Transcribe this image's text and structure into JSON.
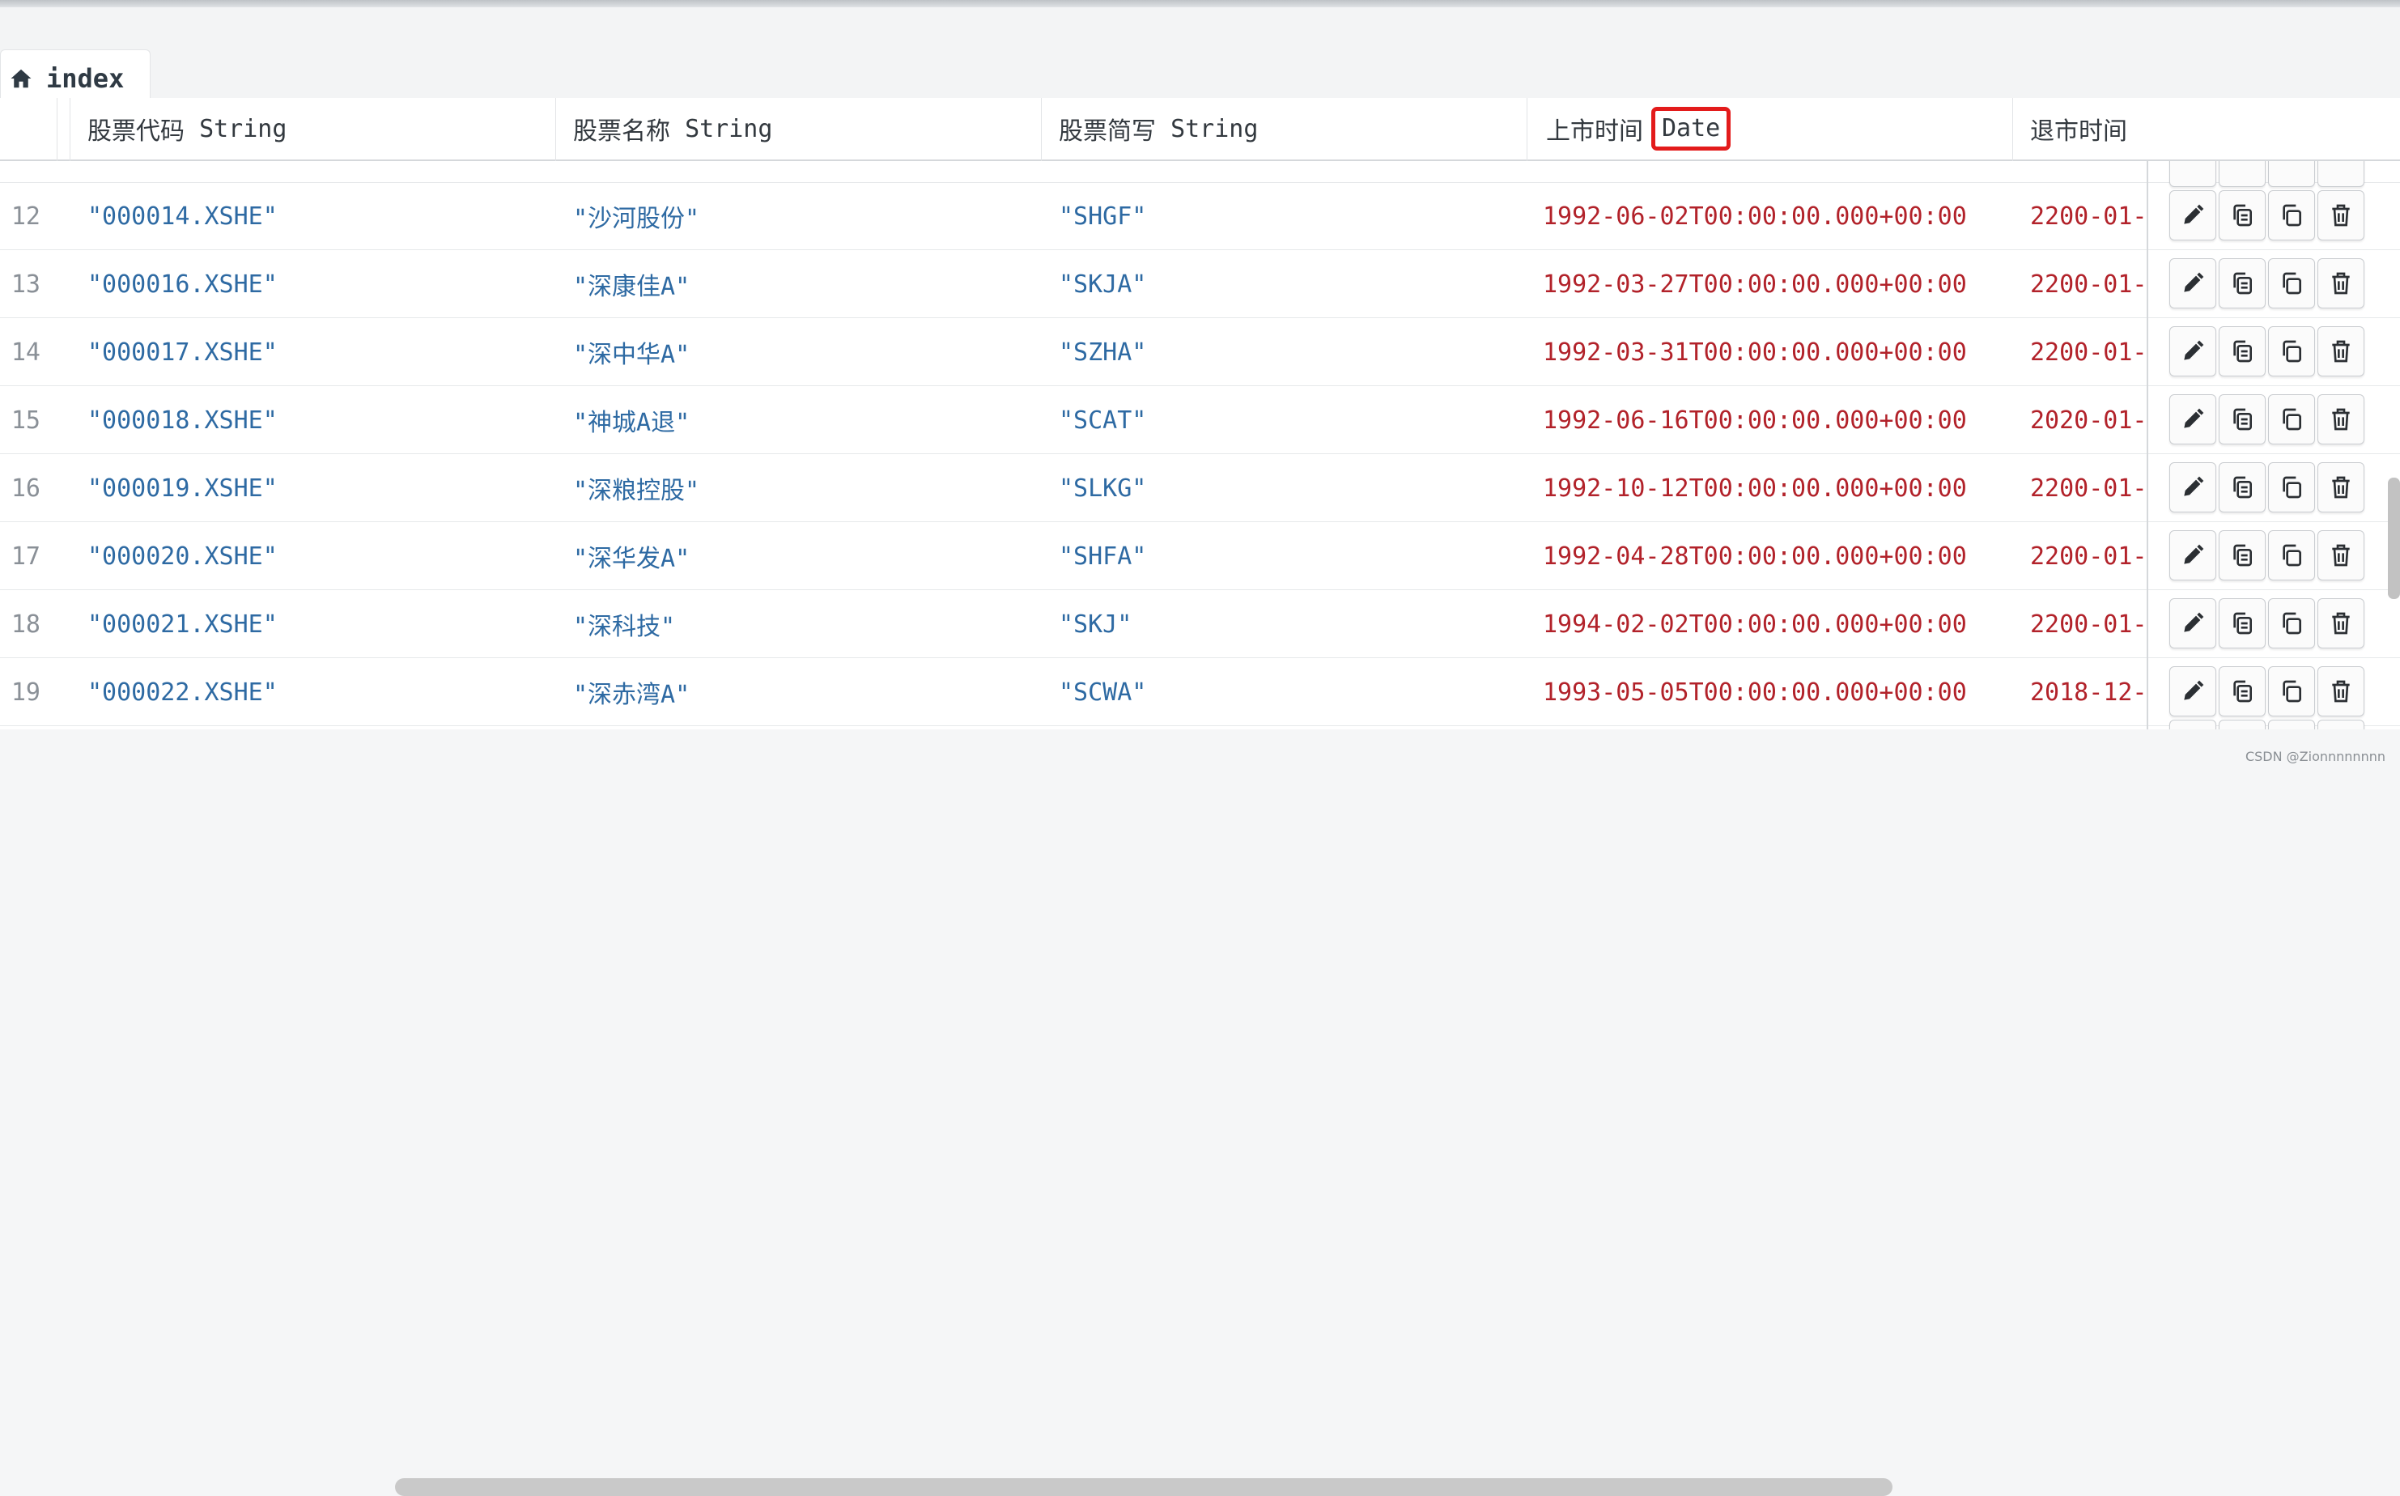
{
  "tab": {
    "label": "index",
    "icon": "home-icon"
  },
  "columns": [
    {
      "name": "股票代码",
      "type": "String"
    },
    {
      "name": "股票名称",
      "type": "String"
    },
    {
      "name": "股票简写",
      "type": "String"
    },
    {
      "name": "上市时间",
      "type": "Date"
    },
    {
      "name": "退市时间",
      "type": ""
    }
  ],
  "rows": [
    {
      "index": "12",
      "code": "\"000014.XSHE\"",
      "name": "\"沙河股份\"",
      "abbr": "\"SHGF\"",
      "list_date": "1992-06-02T00:00:00.000+00:00",
      "delist_date": "2200-01-"
    },
    {
      "index": "13",
      "code": "\"000016.XSHE\"",
      "name": "\"深康佳A\"",
      "abbr": "\"SKJA\"",
      "list_date": "1992-03-27T00:00:00.000+00:00",
      "delist_date": "2200-01-"
    },
    {
      "index": "14",
      "code": "\"000017.XSHE\"",
      "name": "\"深中华A\"",
      "abbr": "\"SZHA\"",
      "list_date": "1992-03-31T00:00:00.000+00:00",
      "delist_date": "2200-01-"
    },
    {
      "index": "15",
      "code": "\"000018.XSHE\"",
      "name": "\"神城A退\"",
      "abbr": "\"SCAT\"",
      "list_date": "1992-06-16T00:00:00.000+00:00",
      "delist_date": "2020-01-"
    },
    {
      "index": "16",
      "code": "\"000019.XSHE\"",
      "name": "\"深粮控股\"",
      "abbr": "\"SLKG\"",
      "list_date": "1992-10-12T00:00:00.000+00:00",
      "delist_date": "2200-01-"
    },
    {
      "index": "17",
      "code": "\"000020.XSHE\"",
      "name": "\"深华发A\"",
      "abbr": "\"SHFA\"",
      "list_date": "1992-04-28T00:00:00.000+00:00",
      "delist_date": "2200-01-"
    },
    {
      "index": "18",
      "code": "\"000021.XSHE\"",
      "name": "\"深科技\"",
      "abbr": "\"SKJ\"",
      "list_date": "1994-02-02T00:00:00.000+00:00",
      "delist_date": "2200-01-"
    },
    {
      "index": "19",
      "code": "\"000022.XSHE\"",
      "name": "\"深赤湾A\"",
      "abbr": "\"SCWA\"",
      "list_date": "1993-05-05T00:00:00.000+00:00",
      "delist_date": "2018-12-"
    }
  ],
  "row_actions": [
    "edit-icon",
    "copy-icon",
    "duplicate-icon",
    "delete-icon"
  ],
  "watermark": "CSDN @Zionnnnnnnn",
  "colors": {
    "string_value": "#2e6aa3",
    "date_value": "#b2222a",
    "highlight_box": "#e31b1b"
  }
}
